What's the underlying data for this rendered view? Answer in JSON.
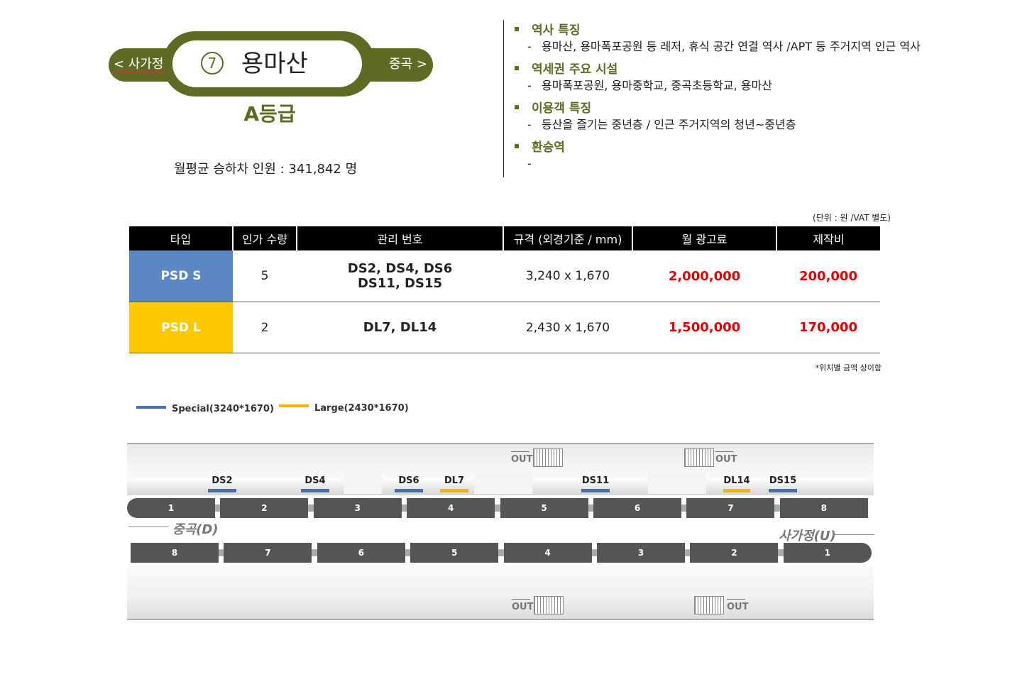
{
  "station": {
    "prev": "< 사가정",
    "next": "중곡 >",
    "number": "7",
    "name": "용마산",
    "grade": "A등급",
    "riders": "월평균 승하차 인원 : 341,842 명"
  },
  "features": [
    {
      "title": "역사 특징",
      "desc": "용마산, 용마폭포공원 등 레저, 휴식 공간 연결 역사 /APT 등 주거지역 인근 역사"
    },
    {
      "title": "역세권 주요 시설",
      "desc": "용마폭포공원, 용마중학교, 중곡초등학교, 용마산"
    },
    {
      "title": "이용객 특징",
      "desc": "등산을 즐기는 중년층 / 인근 주거지역의 청년~중년층"
    },
    {
      "title": "환승역",
      "desc": ""
    }
  ],
  "table": {
    "unit_note": "(단위 : 원 /VAT 별도)",
    "headers": [
      "타입",
      "인가 수량",
      "관리 번호",
      "규격 (외경기준 / mm)",
      "월 광고료",
      "제작비"
    ],
    "rows": [
      {
        "type": "PSD S",
        "qty": "5",
        "ids_line1": "DS2, DS4, DS6",
        "ids_line2": "DS11, DS15",
        "size": "3,240 x 1,670",
        "monthly": "2,000,000",
        "production": "200,000"
      },
      {
        "type": "PSD L",
        "qty": "2",
        "ids_line1": "DL7, DL14",
        "ids_line2": "",
        "size": "2,430 x 1,670",
        "monthly": "1,500,000",
        "production": "170,000"
      }
    ],
    "footnote": "*위치별 금액 상이함"
  },
  "legend": {
    "special": "Special(3240*1670)",
    "large": "Large(2430*1670)",
    "special_color": "#4a6fb0",
    "large_color": "#f5b400"
  },
  "map": {
    "doors": [
      {
        "label": "DS2",
        "kind": "special"
      },
      {
        "label": "DS4",
        "kind": "special"
      },
      {
        "label": "DS6",
        "kind": "special"
      },
      {
        "label": "DL7",
        "kind": "large"
      },
      {
        "label": "DS11",
        "kind": "special"
      },
      {
        "label": "DL14",
        "kind": "large"
      },
      {
        "label": "DS15",
        "kind": "special"
      }
    ],
    "out_label": "OUT",
    "top_train_cars": [
      "1",
      "2",
      "3",
      "4",
      "5",
      "6",
      "7",
      "8"
    ],
    "bottom_train_cars": [
      "8",
      "7",
      "6",
      "5",
      "4",
      "3",
      "2",
      "1"
    ],
    "dir_left": "중곡(D)",
    "dir_right": "사가정(U)"
  }
}
